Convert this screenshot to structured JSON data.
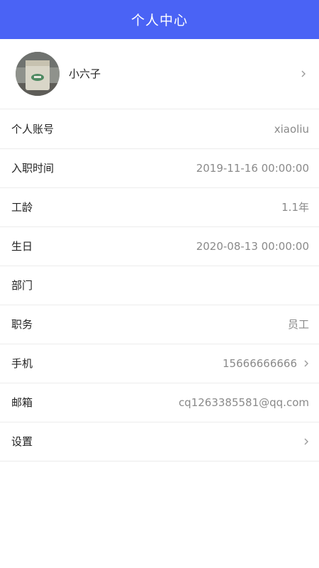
{
  "header": {
    "title": "个人中心"
  },
  "profile": {
    "name": "小六子",
    "avatar_icon": "avatar-photo"
  },
  "rows": [
    {
      "label": "个人账号",
      "value": "xiaoliu"
    },
    {
      "label": "入职时间",
      "value": "2019-11-16 00:00:00"
    },
    {
      "label": "工龄",
      "value": "1.1年"
    },
    {
      "label": "生日",
      "value": "2020-08-13 00:00:00"
    },
    {
      "label": "部门",
      "value": ""
    },
    {
      "label": "职务",
      "value": "员工"
    },
    {
      "label": "手机",
      "value": "15666666666"
    },
    {
      "label": "邮箱",
      "value": "cq1263385581@qq.com"
    },
    {
      "label": "设置",
      "value": ""
    }
  ],
  "colors": {
    "header": "#4a63f5",
    "value_text": "#8a8a8a",
    "divider": "#ececec"
  },
  "icons": {
    "row_arrow": "chevron-right-icon"
  }
}
